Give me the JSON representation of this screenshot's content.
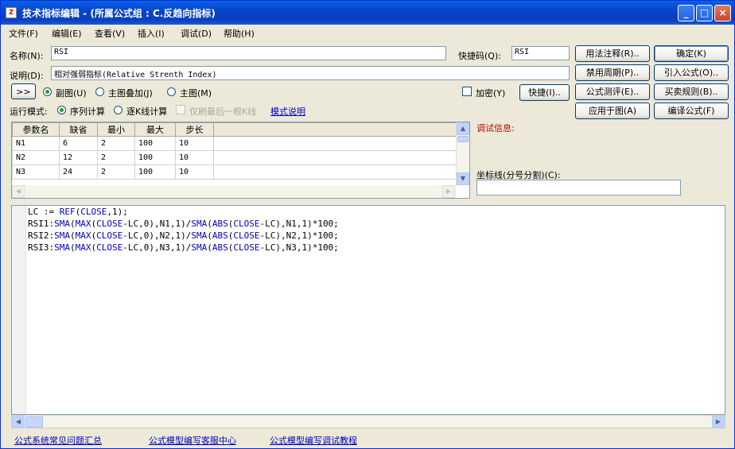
{
  "window": {
    "title": "技术指标编辑 - (所属公式组 : C.反趋向指标)",
    "app_icon": "zb-icon"
  },
  "menu": [
    "文件(F)",
    "编辑(E)",
    "查看(V)",
    "插入(I)",
    "调试(D)",
    "帮助(H)"
  ],
  "form": {
    "name_label": "名称(N):",
    "name_value": "RSI",
    "shortcut_label": "快捷码(Q):",
    "shortcut_value": "RSI",
    "desc_label": "说明(D):",
    "desc_value": "相对强弱指标(Relative Strenth Index)",
    "expand_label": ">>",
    "radio_sub": "副图(U)",
    "radio_overlay": "主图叠加(J)",
    "radio_main": "主图(M)",
    "encrypt": "加密(Y)",
    "quick": "快捷(I)..",
    "mode_label": "运行模式:",
    "mode_seq": "序列计算",
    "mode_kline": "逐K线计算",
    "only_last": "仅刷最后一根K线",
    "mode_help": "模式说明"
  },
  "buttons": {
    "usage": "用法注释(R)..",
    "ok": "确定(K)",
    "disable_period": "禁用周期(P)..",
    "import": "引入公式(O)..",
    "evaluate": "公式测评(E)..",
    "trade_rule": "买卖规则(B)..",
    "apply": "应用于图(A)",
    "compile": "编译公式(F)"
  },
  "params": {
    "headers": [
      "参数名",
      "缺省",
      "最小",
      "最大",
      "步长"
    ],
    "rows": [
      [
        "N1",
        "6",
        "2",
        "100",
        "10"
      ],
      [
        "N2",
        "12",
        "2",
        "100",
        "10"
      ],
      [
        "N3",
        "24",
        "2",
        "100",
        "10"
      ]
    ]
  },
  "debug": {
    "label": "调试信息:",
    "axis_label": "坐标线(分号分割)(C):",
    "axis_value": ""
  },
  "code_lines": [
    "LC := REF(CLOSE,1);",
    "RSI1:SMA(MAX(CLOSE-LC,0),N1,1)/SMA(ABS(CLOSE-LC),N1,1)*100;",
    "RSI2:SMA(MAX(CLOSE-LC,0),N2,1)/SMA(ABS(CLOSE-LC),N2,1)*100;",
    "RSI3:SMA(MAX(CLOSE-LC,0),N3,1)/SMA(ABS(CLOSE-LC),N3,1)*100;"
  ],
  "footer_links": [
    "公式系统常见问题汇总",
    "公式模型编写客服中心",
    "公式模型编写调试教程"
  ]
}
